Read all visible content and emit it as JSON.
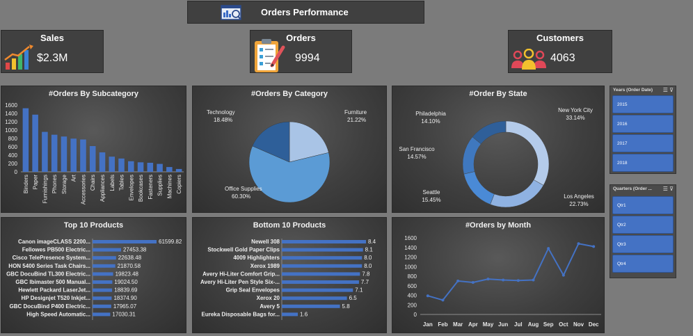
{
  "header": {
    "title": "Orders Performance",
    "icon": "dashboard-icon"
  },
  "kpis": {
    "sales": {
      "title": "Sales",
      "value": "$2.3M",
      "icon": "growth-chart-icon"
    },
    "orders": {
      "title": "Orders",
      "value": "9994",
      "icon": "clipboard-icon"
    },
    "customers": {
      "title": "Customers",
      "value": "4063",
      "icon": "people-icon"
    }
  },
  "colors": {
    "bar": "#4472c4",
    "line": "#4472c4",
    "slicer": "#4472c4"
  },
  "slicers": {
    "years": {
      "title": "Years (Order Date)",
      "items": [
        "2015",
        "2016",
        "2017",
        "2018"
      ]
    },
    "quarters": {
      "title": "Quarters (Order ...",
      "items": [
        "Qtr1",
        "Qtr2",
        "Qtr3",
        "Qtr4"
      ]
    }
  },
  "chart_data": [
    {
      "type": "bar",
      "title": "#Orders By Subcategory",
      "categories": [
        "Binders",
        "Paper",
        "Furnishings",
        "Phones",
        "Storage",
        "Art",
        "Accessories",
        "Chairs",
        "Appliances",
        "Labels",
        "Tables",
        "Envelopes",
        "Bookcases",
        "Fasteners",
        "Supplies",
        "Machines",
        "Copiers"
      ],
      "values": [
        1523,
        1370,
        957,
        889,
        846,
        796,
        775,
        617,
        466,
        364,
        319,
        254,
        228,
        217,
        190,
        115,
        68
      ],
      "ylim": [
        0,
        1600
      ],
      "yticks": [
        "1600",
        "1400",
        "1200",
        "1000",
        "800",
        "600",
        "400",
        "200",
        "0"
      ]
    },
    {
      "type": "pie",
      "title": "#Orders By Category",
      "slices": [
        {
          "label": "Furniture",
          "pct": "21.22%",
          "value": 21.22
        },
        {
          "label": "Office Supplies",
          "pct": "60.30%",
          "value": 60.3
        },
        {
          "label": "Technology",
          "pct": "18.48%",
          "value": 18.48
        }
      ]
    },
    {
      "type": "pie",
      "title": "#Order By State",
      "slices": [
        {
          "label": "New York City",
          "pct": "33.14%",
          "value": 33.14
        },
        {
          "label": "Los Angeles",
          "pct": "22.73%",
          "value": 22.73
        },
        {
          "label": "Seattle",
          "pct": "15.45%",
          "value": 15.45
        },
        {
          "label": "San Francisco",
          "pct": "14.57%",
          "value": 14.57
        },
        {
          "label": "Philadelphia",
          "pct": "14.10%",
          "value": 14.1
        }
      ]
    },
    {
      "type": "bar",
      "title": "Top 10 Products",
      "categories": [
        "Canon imageCLASS 2200...",
        "Fellowes PB500 Electric...",
        "Cisco TelePresence System...",
        "HON 5400 Series Task Chairs...",
        "GBC DocuBind TL300 Electric...",
        "GBC Ibimaster 500 Manual...",
        "Hewlett Packard LaserJet...",
        "HP Designjet T520 Inkjet...",
        "GBC DocuBind P400 Electric...",
        "High Speed Automatic..."
      ],
      "values": [
        61599.82,
        27453.38,
        22638.48,
        21870.58,
        19823.48,
        19024.5,
        18839.69,
        18374.9,
        17965.07,
        17030.31
      ],
      "labels": [
        "61599.82",
        "27453.38",
        "22638.48",
        "21870.58",
        "19823.48",
        "19024.50",
        "18839.69",
        "18374.90",
        "17965.07",
        "17030.31"
      ]
    },
    {
      "type": "bar",
      "title": "Bottom 10 Products",
      "categories": [
        "Newell 308",
        "Stockwell Gold Paper Clips",
        "4009 Highlighters",
        "Xerox 1989",
        "Avery Hi-Liter Comfort Grip...",
        "Avery Hi-Liter Pen Style Six-...",
        "Grip Seal Envelopes",
        "Xerox 20",
        "Avery 5",
        "Eureka Disposable Bags for..."
      ],
      "values": [
        8.4,
        8.1,
        8.0,
        8.0,
        7.8,
        7.7,
        7.1,
        6.5,
        5.8,
        1.6
      ],
      "labels": [
        "8.4",
        "8.1",
        "8.0",
        "8.0",
        "7.8",
        "7.7",
        "7.1",
        "6.5",
        "5.8",
        "1.6"
      ]
    },
    {
      "type": "line",
      "title": "#Orders by Month",
      "x": [
        "Jan",
        "Feb",
        "Mar",
        "Apr",
        "May",
        "Jun",
        "Jul",
        "Aug",
        "Sep",
        "Oct",
        "Nov",
        "Dec"
      ],
      "values": [
        390,
        300,
        700,
        670,
        740,
        720,
        710,
        720,
        1380,
        820,
        1480,
        1420
      ],
      "ylim": [
        0,
        1600
      ],
      "yticks": [
        "1600",
        "1400",
        "1200",
        "1000",
        "800",
        "600",
        "400",
        "200",
        "0"
      ]
    }
  ]
}
